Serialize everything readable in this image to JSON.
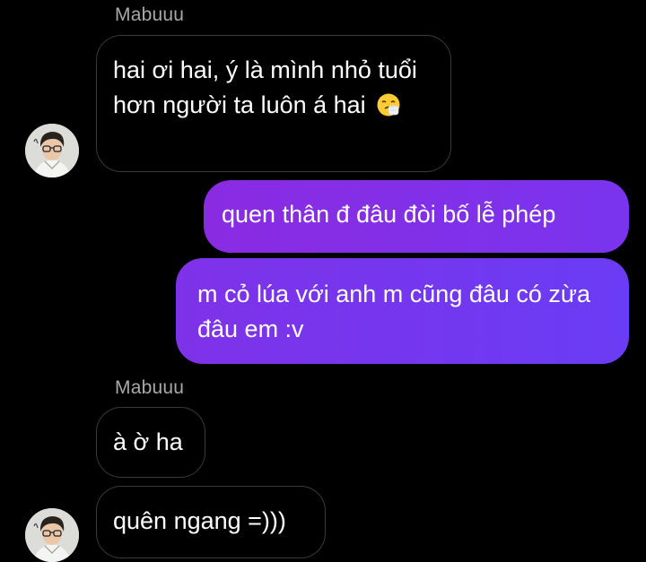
{
  "conversation": {
    "sender_name_1": "Mabuuu",
    "sender_name_2": "Mabuuu",
    "messages": [
      {
        "from": "them",
        "text": "hai ơi hai, ý là mình nhỏ tuổi hơn người ta luôn á hai",
        "emoji": "sneezing-face-emoji"
      },
      {
        "from": "me",
        "text": "quen thân đ đâu đòi bố lễ phép"
      },
      {
        "from": "me",
        "text": "m cỏ lúa với anh m cũng đâu có zừa đâu em :v"
      },
      {
        "from": "them",
        "text": "à ờ ha"
      },
      {
        "from": "them",
        "text": "quên ngang =)))"
      }
    ]
  },
  "icons": {
    "avatar": "user-avatar-icon",
    "emoji": "sneezing-face-emoji"
  },
  "colors": {
    "background": "#000000",
    "incoming_border": "#3a3a3a",
    "incoming_text": "#ffffff",
    "outgoing_gradient_start": "#8a2be2",
    "outgoing_gradient_end": "#6a3cf5",
    "sender_name": "#a8a8a8"
  }
}
